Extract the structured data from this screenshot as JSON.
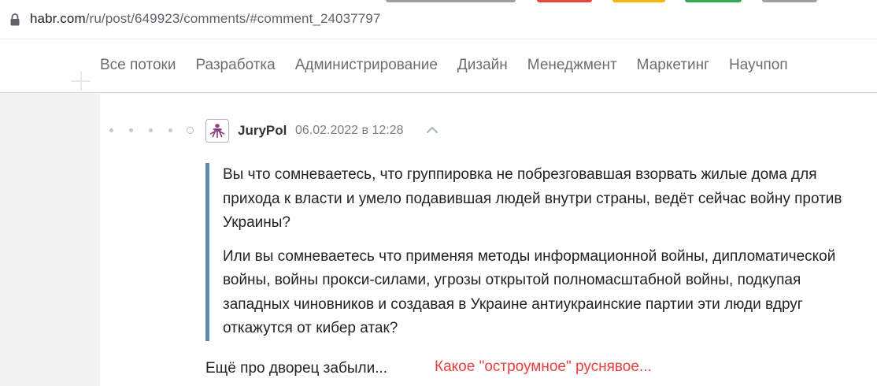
{
  "browser": {
    "url_host": "habr.com",
    "url_path": "/ru/post/649923/comments/#comment_24037797"
  },
  "colors": {
    "accent": "#5b8bb3",
    "annotation": "#e8403c",
    "tab_stripes": [
      "#9aa0a6",
      "#e8453c",
      "#f5b400",
      "#34a853",
      "#9aa0a6"
    ]
  },
  "nav": {
    "items": [
      {
        "label": "Все потоки"
      },
      {
        "label": "Разработка"
      },
      {
        "label": "Администрирование"
      },
      {
        "label": "Дизайн"
      },
      {
        "label": "Менеджмент"
      },
      {
        "label": "Маркетинг"
      },
      {
        "label": "Научпоп"
      }
    ]
  },
  "comment": {
    "username": "JuryPol",
    "datetime": "06.02.2022 в 12:28",
    "quote_paragraphs": [
      "Вы что сомневаетесь, что группировка не побрезговавшая взорвать жилые дома для прихода к власти и умело подавившая людей внутри страны, ведёт сейчас войну против Украины?",
      "Или вы сомневаетесь что применяя методы информационной войны, дипломатической войны, войны прокси-силами, угрозы открытой полномасштабной войны, подкупая западных чиновников и создавая в Украине антиукраинские партии эти люди вдруг откажутся от кибер атак?"
    ],
    "reply": "Ещё про дворец забыли...",
    "annotation": "Какое \"остроумное\" руснявое..."
  }
}
